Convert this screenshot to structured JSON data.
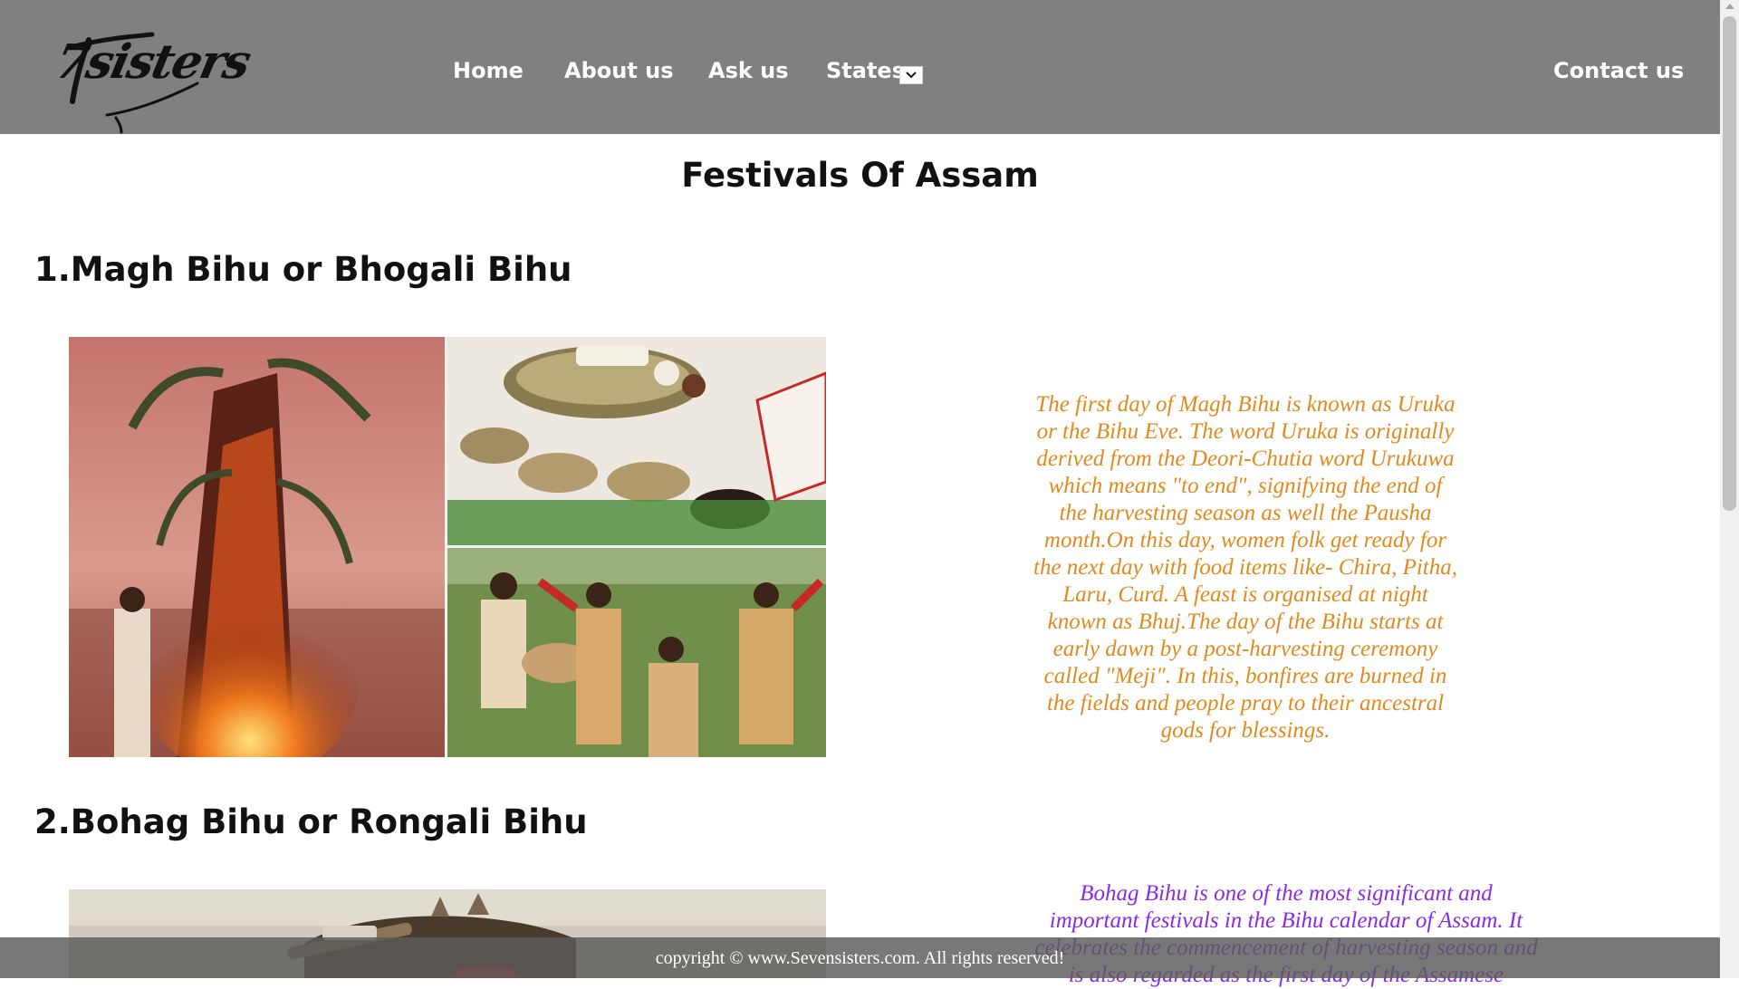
{
  "header": {
    "logo_text": "7sisters",
    "nav": {
      "home": "Home",
      "about": "About us",
      "ask": "Ask us",
      "states": "States",
      "contact": "Contact us"
    }
  },
  "main": {
    "page_title": "Festivals Of Assam",
    "sections": [
      {
        "title": "1.Magh Bihu or Bhogali Bihu",
        "description": "The first day of Magh Bihu is known as Uruka or the Bihu Eve. The word Uruka is originally derived from the Deori-Chutia word Urukuwa which means \"to end\", signifying the end of the harvesting season as well the Pausha month.On this day, women folk get ready for the next day with food items like- Chira, Pitha, Laru, Curd. A feast is organised at night known as Bhuj.The day of the Bihu starts at early dawn by a post-harvesting ceremony called \"Meji\". In this, bonfires are burned in the fields and people pray to their ancestral gods for blessings.",
        "text_color": "#e08a1e"
      },
      {
        "title": "2.Bohag Bihu or Rongali Bihu",
        "description": "Bohag Bihu is one of the most significant and important festivals in the Bihu calendar of Assam. It celebrates the commencement of harvesting season and is also regarded as the first day of the Assamese",
        "text_color": "#8a2be2"
      }
    ]
  },
  "footer": {
    "copyright": "copyright © www.Sevensisters.com. All rights reserved!"
  },
  "colors": {
    "header_bg": "#808080",
    "nav_text": "#ffffff",
    "footer_bg": "#5a5a5a"
  }
}
